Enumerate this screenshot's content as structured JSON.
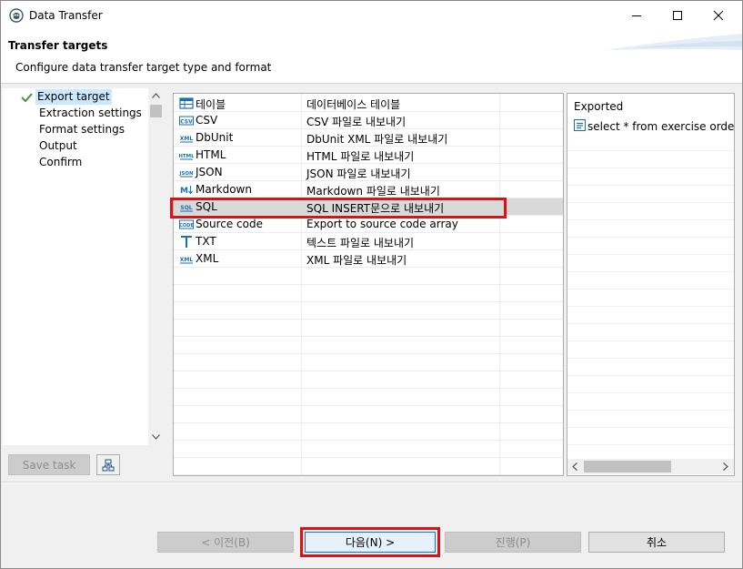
{
  "window": {
    "title": "Data Transfer"
  },
  "header": {
    "title": "Transfer targets",
    "subtitle": "Configure data transfer target type and format"
  },
  "nav": {
    "items": [
      {
        "label": "Export target",
        "selected": true,
        "done": true
      },
      {
        "label": "Extraction settings"
      },
      {
        "label": "Format settings"
      },
      {
        "label": "Output"
      },
      {
        "label": "Confirm"
      }
    ]
  },
  "left_buttons": {
    "save_task": "Save task"
  },
  "formats": [
    {
      "name": "테이블",
      "desc": "데이터베이스 테이블",
      "icon": "table-icon"
    },
    {
      "name": "CSV",
      "desc": "CSV 파일로 내보내기",
      "icon": "csv-icon"
    },
    {
      "name": "DbUnit",
      "desc": "DbUnit XML 파일로 내보내기",
      "icon": "xml-icon"
    },
    {
      "name": "HTML",
      "desc": "HTML 파일로 내보내기",
      "icon": "html-icon"
    },
    {
      "name": "JSON",
      "desc": "JSON 파일로 내보내기",
      "icon": "json-icon"
    },
    {
      "name": "Markdown",
      "desc": "Markdown 파일로 내보내기",
      "icon": "markdown-icon"
    },
    {
      "name": "SQL",
      "desc": "SQL INSERT문으로 내보내기",
      "icon": "sql-icon",
      "selected": true
    },
    {
      "name": "Source code",
      "desc": "Export to source code array",
      "icon": "code-icon"
    },
    {
      "name": "TXT",
      "desc": "텍스트 파일로 내보내기",
      "icon": "txt-icon"
    },
    {
      "name": "XML",
      "desc": "XML 파일로 내보내기",
      "icon": "xml-icon"
    }
  ],
  "preview": {
    "label": "Exported",
    "query": "select * from exercise order by"
  },
  "footer": {
    "back": "< 이전(B)",
    "next": "다음(N) >",
    "finish": "진행(P)",
    "cancel": "취소"
  }
}
